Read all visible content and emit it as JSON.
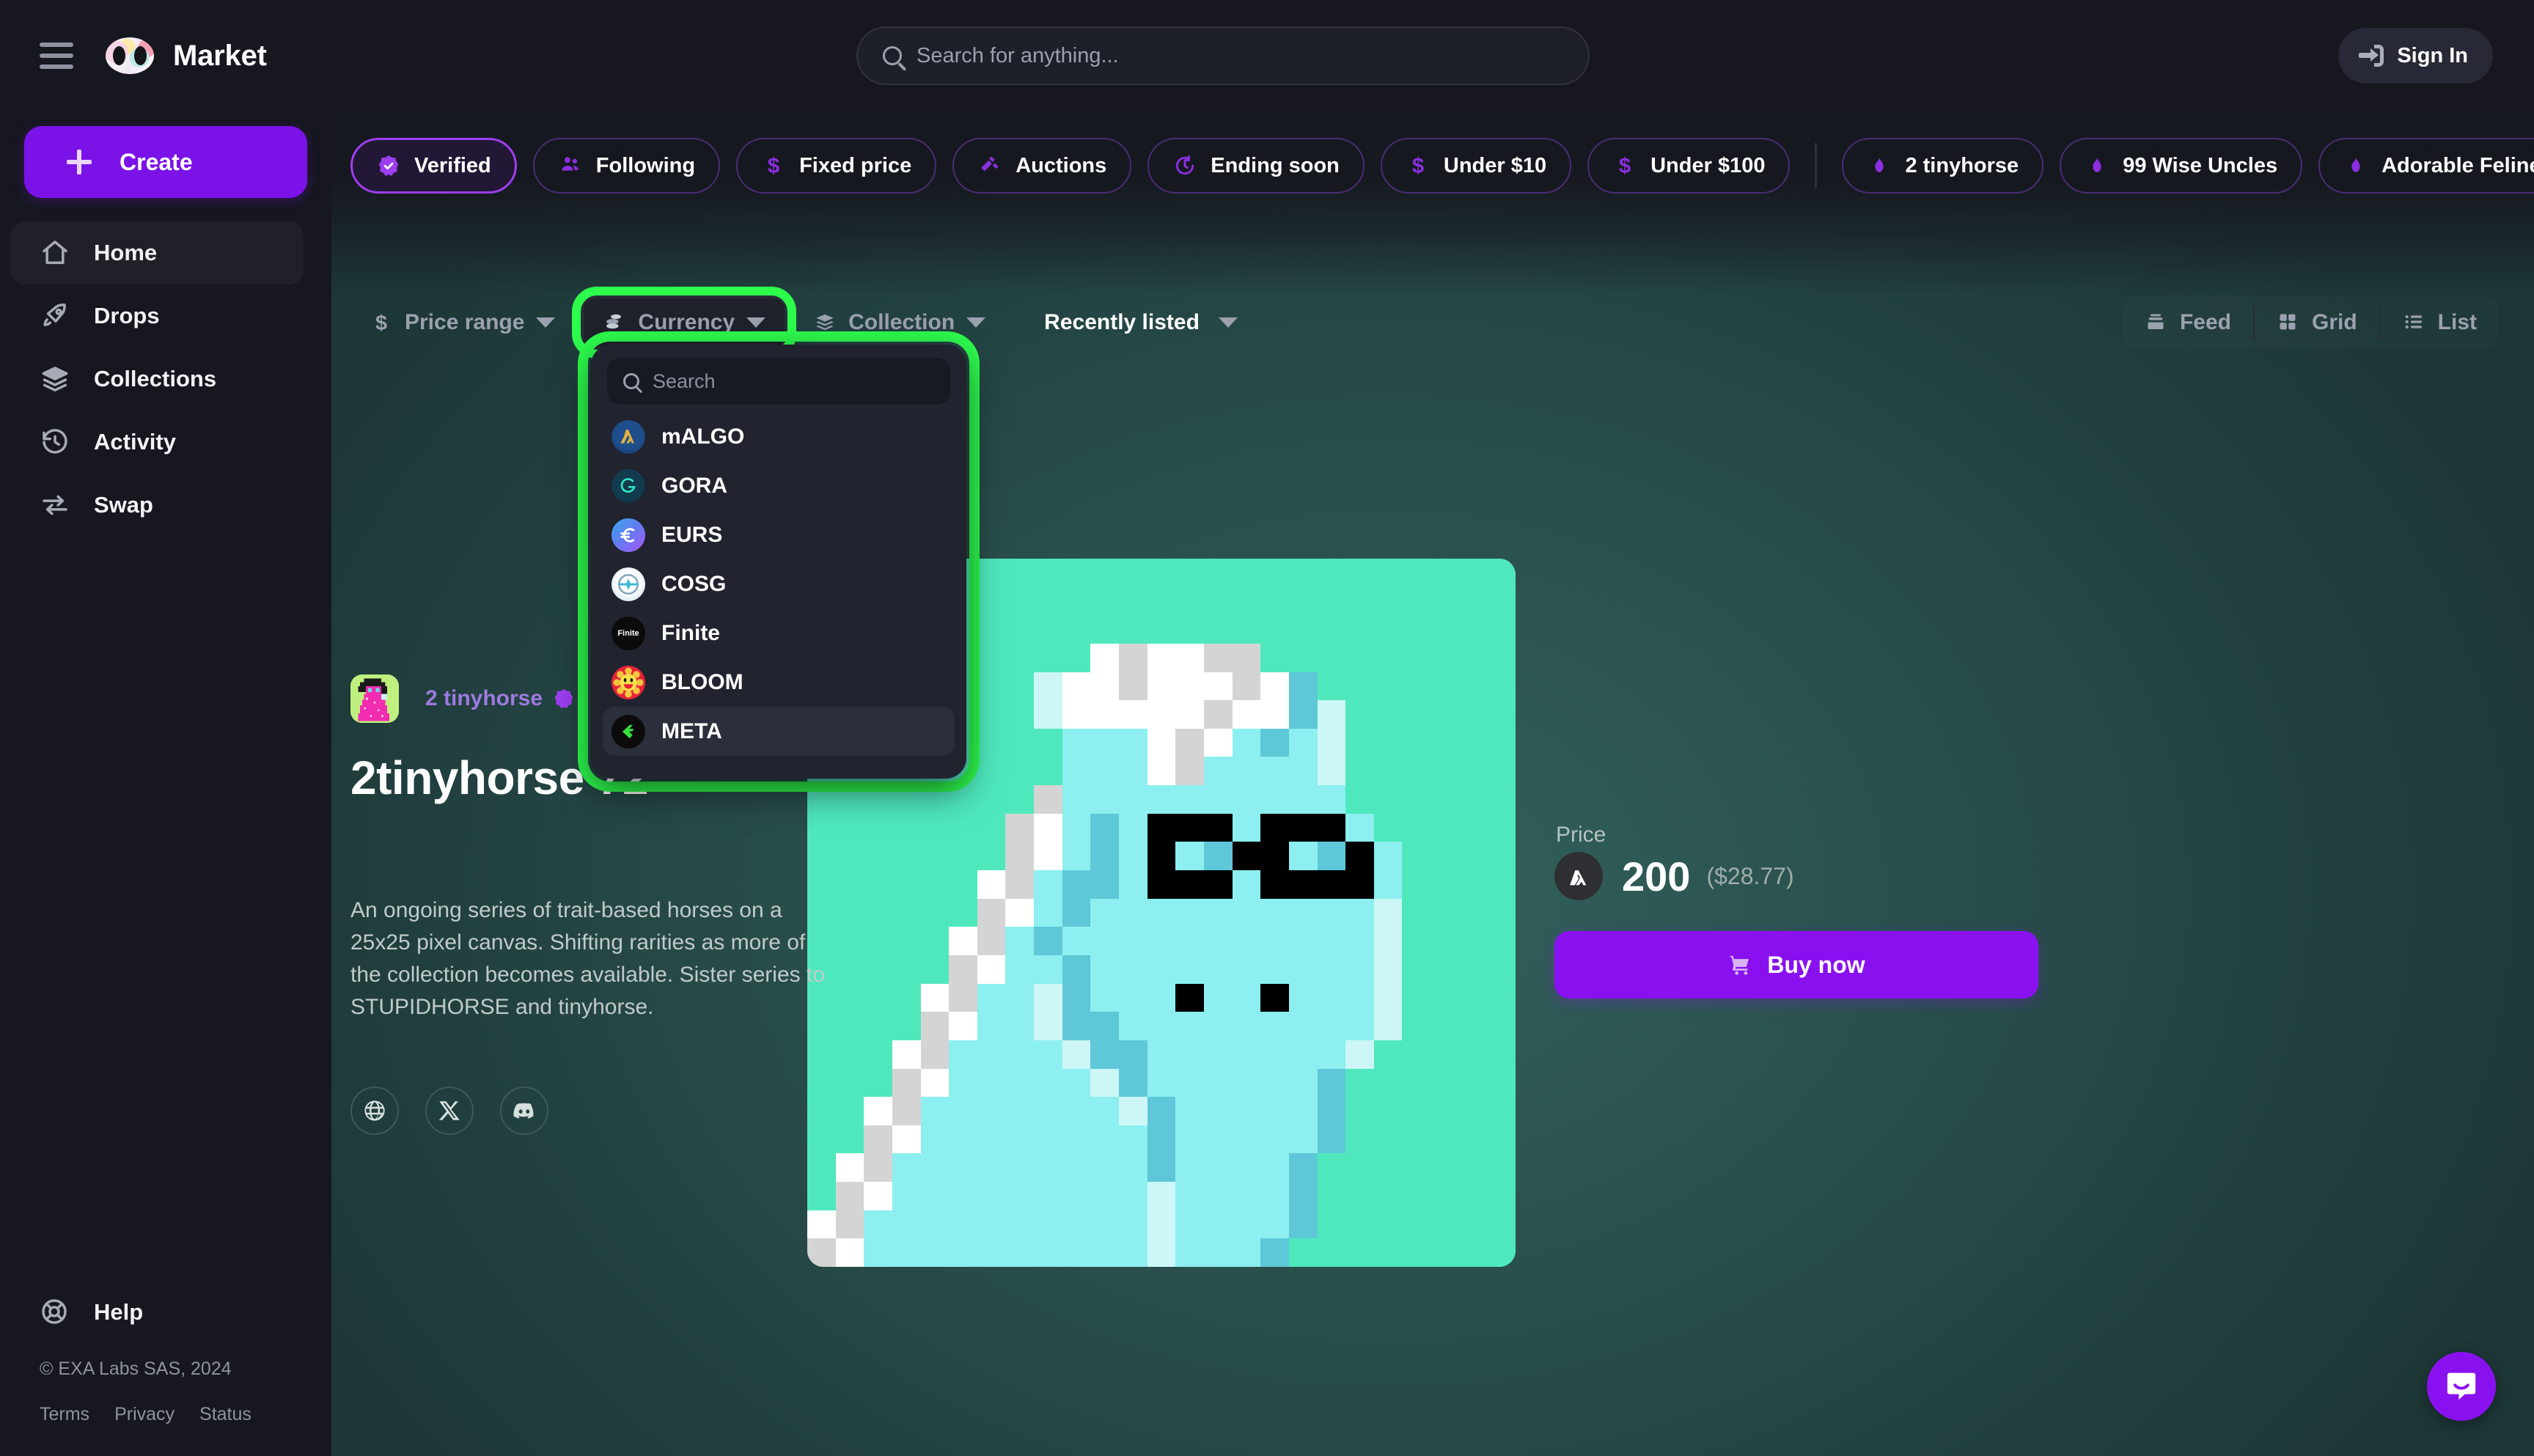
{
  "header": {
    "menu_icon": "hamburger-icon",
    "logo_icon": "exa-infinity-logo",
    "title": "Market",
    "search": {
      "placeholder": "Search for anything...",
      "value": "",
      "icon": "search-icon"
    },
    "sign_in": {
      "label": "Sign In",
      "icon": "login-icon"
    }
  },
  "sidebar": {
    "create": {
      "label": "Create",
      "icon": "plus-icon"
    },
    "items": [
      {
        "label": "Home",
        "icon": "home-icon",
        "active": true
      },
      {
        "label": "Drops",
        "icon": "rocket-icon",
        "active": false
      },
      {
        "label": "Collections",
        "icon": "layers-icon",
        "active": false
      },
      {
        "label": "Activity",
        "icon": "history-clock-icon",
        "active": false
      },
      {
        "label": "Swap",
        "icon": "swap-arrows-icon",
        "active": false
      }
    ],
    "help": {
      "label": "Help",
      "icon": "lifebuoy-icon"
    },
    "copyright": "© EXA Labs SAS, 2024",
    "legal": [
      "Terms",
      "Privacy",
      "Status"
    ]
  },
  "chips": [
    {
      "label": "Verified",
      "icon": "verified-badge-icon",
      "selected": true
    },
    {
      "label": "Following",
      "icon": "users-icon",
      "selected": false
    },
    {
      "label": "Fixed price",
      "icon": "dollar-icon",
      "selected": false
    },
    {
      "label": "Auctions",
      "icon": "gavel-icon",
      "selected": false
    },
    {
      "label": "Ending soon",
      "icon": "timer-icon",
      "selected": false
    },
    {
      "label": "Under $10",
      "icon": "dollar-icon",
      "selected": false
    },
    {
      "label": "Under $100",
      "icon": "dollar-icon",
      "selected": false
    },
    {
      "label": "2 tinyhorse",
      "icon": "flame-icon",
      "selected": false,
      "after_divider": true
    },
    {
      "label": "99 Wise Uncles",
      "icon": "flame-icon",
      "selected": false
    },
    {
      "label": "Adorable Felines",
      "icon": "flame-icon",
      "selected": false
    }
  ],
  "toolbar": {
    "price_range": {
      "label": "Price range",
      "icon": "dollar-icon"
    },
    "currency": {
      "label": "Currency",
      "icon": "coins-icon",
      "highlighted": true,
      "highlight_color": "#2dfc4d"
    },
    "collection": {
      "label": "Collection",
      "icon": "layers-icon"
    },
    "sort": {
      "label": "Recently listed"
    },
    "views": [
      {
        "label": "Feed",
        "icon": "feed-icon"
      },
      {
        "label": "Grid",
        "icon": "grid-icon"
      },
      {
        "label": "List",
        "icon": "list-icon"
      }
    ]
  },
  "currency_dropdown": {
    "open": true,
    "search": {
      "placeholder": "Search",
      "value": "",
      "icon": "search-icon"
    },
    "options": [
      {
        "label": "mALGO",
        "icon": "malgo-token-icon",
        "hovered": false
      },
      {
        "label": "GORA",
        "icon": "gora-token-icon",
        "hovered": false
      },
      {
        "label": "EURS",
        "icon": "eurs-token-icon",
        "hovered": false
      },
      {
        "label": "COSG",
        "icon": "cosg-token-icon",
        "hovered": false
      },
      {
        "label": "Finite",
        "icon": "finite-token-icon",
        "hovered": false
      },
      {
        "label": "BLOOM",
        "icon": "bloom-token-icon",
        "hovered": false
      },
      {
        "label": "META",
        "icon": "meta-token-icon",
        "hovered": true
      }
    ]
  },
  "item": {
    "collection_name": "2 tinyhorse",
    "collection_verified": true,
    "collection_avatar_icon": "pink-horse-avatar",
    "title": "2tinyhorse 72",
    "description": "An ongoing series of trait-based horses on a 25x25 pixel canvas. Shifting rarities as more of the collection becomes available. Sister series to STUPIDHORSE and tinyhorse.",
    "socials": [
      {
        "name": "website",
        "icon": "globe-icon"
      },
      {
        "name": "twitter",
        "icon": "x-twitter-icon"
      },
      {
        "name": "discord",
        "icon": "discord-icon"
      }
    ],
    "artwork": {
      "icon": "pixel-horse-artwork",
      "background_color": "#4fe8bd",
      "body_color": "#8defef",
      "mane_white": "#ffffff",
      "mane_gray": "#d4d4d4",
      "shade_color": "#5ec8d8",
      "light_color": "#cdf7f7",
      "eye_color": "#000000"
    },
    "price": {
      "label": "Price",
      "currency_icon": "algorand-icon",
      "amount": "200",
      "fiat": "($28.77)"
    },
    "buy": {
      "label": "Buy now",
      "icon": "cart-icon"
    }
  },
  "chat": {
    "icon": "intercom-chat-icon",
    "color": "#8911f0"
  }
}
